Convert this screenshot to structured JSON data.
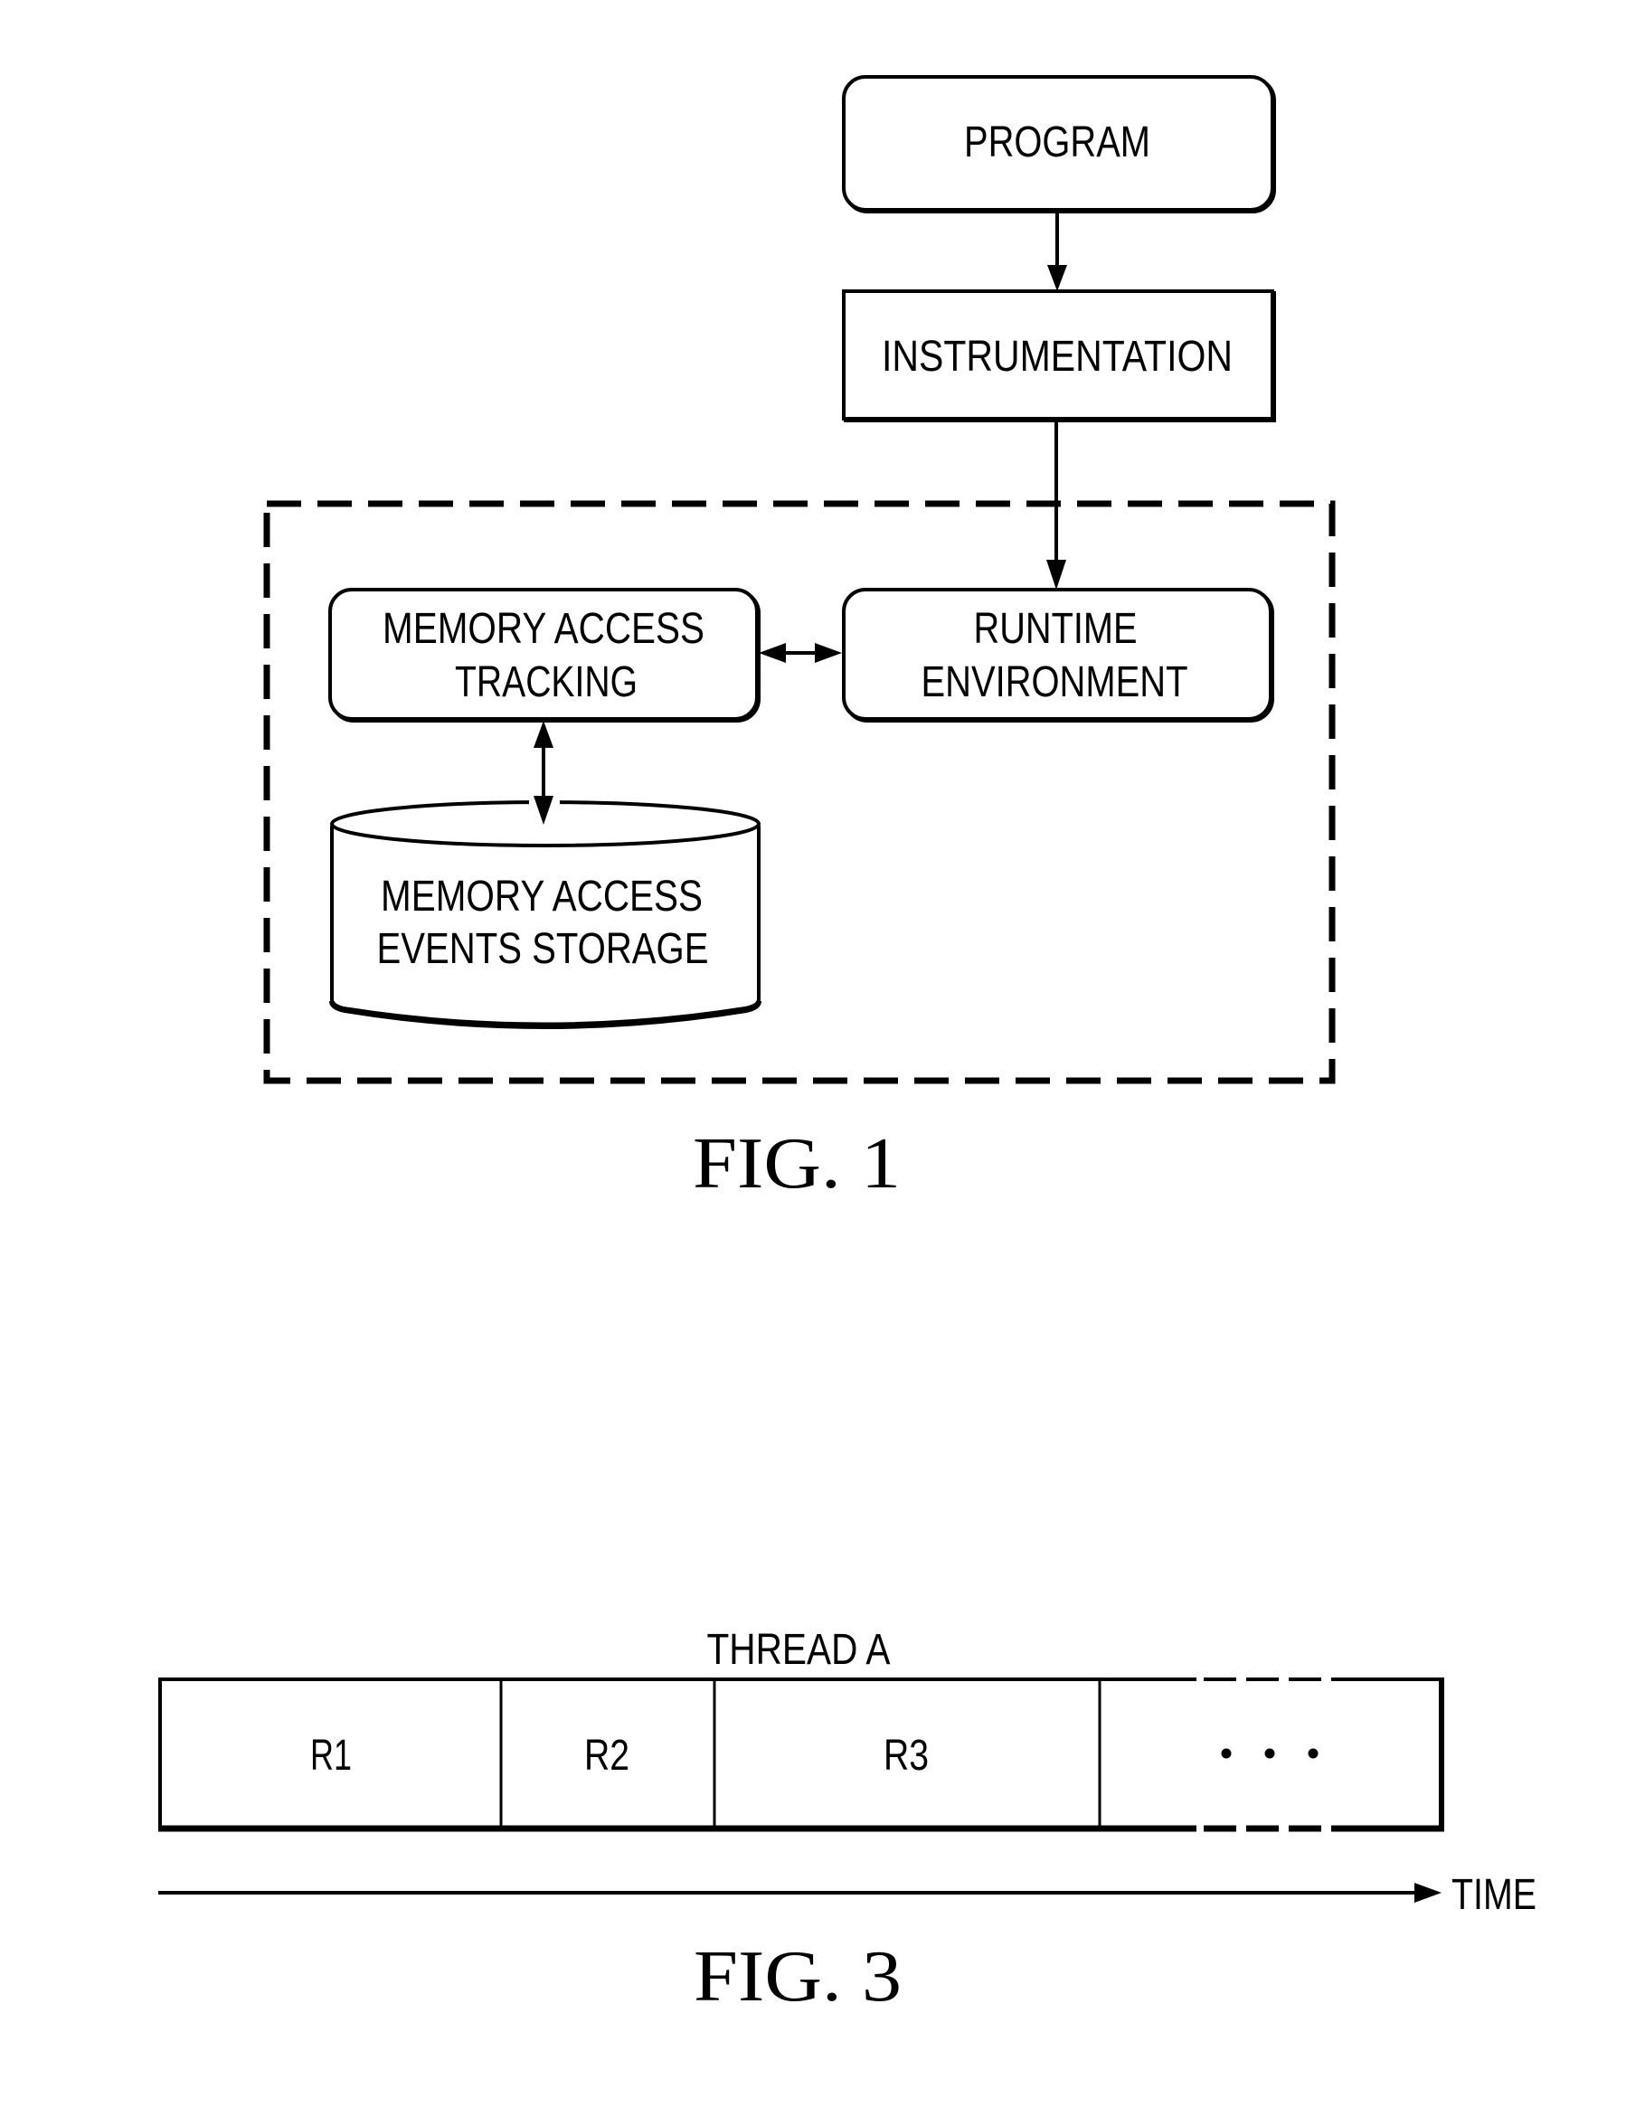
{
  "figure1": {
    "caption": "FIG. 1",
    "nodes": {
      "program": {
        "label": "PROGRAM"
      },
      "instrumentation": {
        "label": "INSTRUMENTATION"
      },
      "runtime": {
        "line1": "RUNTIME",
        "line2": "ENVIRONMENT"
      },
      "tracking": {
        "line1": "MEMORY ACCESS",
        "line2": "TRACKING"
      },
      "storage": {
        "line1": "MEMORY ACCESS",
        "line2": "EVENTS STORAGE"
      }
    },
    "edges": [
      {
        "from": "program",
        "to": "instrumentation",
        "direction": "one-way"
      },
      {
        "from": "instrumentation",
        "to": "runtime",
        "direction": "one-way"
      },
      {
        "from": "tracking",
        "to": "runtime",
        "direction": "two-way"
      },
      {
        "from": "tracking",
        "to": "storage",
        "direction": "two-way"
      }
    ],
    "group": {
      "style": "dashed",
      "members": [
        "tracking",
        "runtime",
        "storage"
      ]
    }
  },
  "figure3": {
    "caption": "FIG. 3",
    "thread_label": "THREAD A",
    "regions": [
      "R1",
      "R2",
      "R3"
    ],
    "continuation": "• • •",
    "axis_label": "TIME"
  }
}
